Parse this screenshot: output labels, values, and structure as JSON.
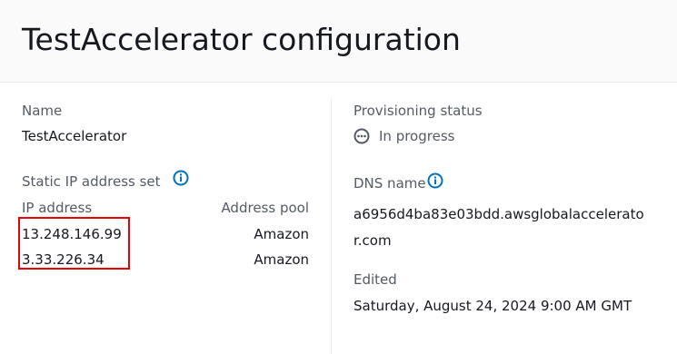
{
  "header": {
    "title": "TestAccelerator configuration"
  },
  "left": {
    "name_label": "Name",
    "name_value": "TestAccelerator",
    "static_ip_label": "Static IP address set",
    "ip_table": {
      "col_ip": "IP address",
      "col_pool": "Address pool",
      "rows": [
        {
          "ip": "13.248.146.99",
          "pool": "Amazon"
        },
        {
          "ip": "3.33.226.34",
          "pool": "Amazon"
        }
      ]
    }
  },
  "right": {
    "provisioning_label": "Provisioning status",
    "provisioning_value": "In progress",
    "dns_label": "DNS name",
    "dns_value": "a6956d4ba83e03bdd.awsglobalaccelerator.com",
    "edited_label": "Edited",
    "edited_value": "Saturday, August 24, 2024 9:00 AM GMT"
  },
  "colors": {
    "info_icon": "#0073bb",
    "highlight": "#e8000b",
    "status_icon": "#545b64"
  },
  "icons": {
    "info": "info-icon",
    "status": "status-in-progress-icon"
  }
}
